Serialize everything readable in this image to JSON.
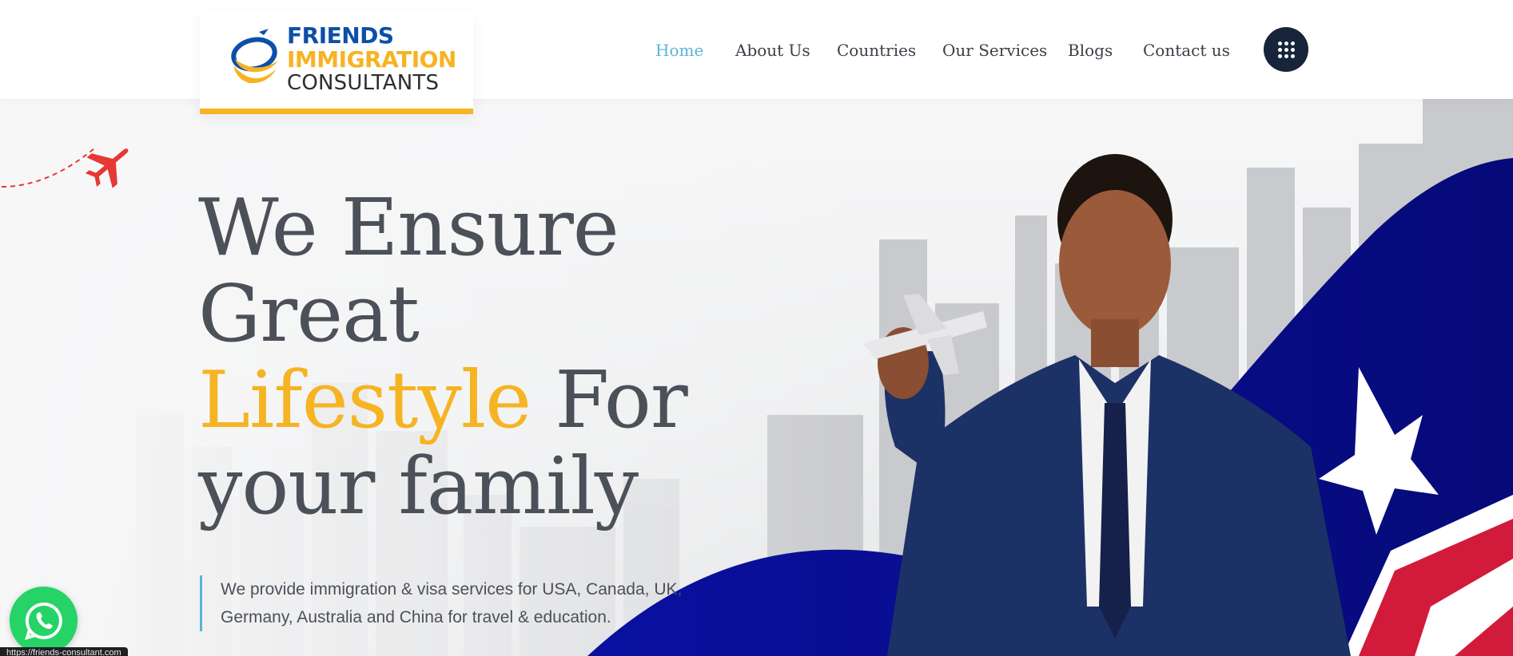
{
  "header": {
    "logo": {
      "line1": "FRIENDS",
      "line2": "IMMIGRATION",
      "line3": "CONSULTANTS"
    },
    "nav": [
      {
        "label": "Home",
        "active": true
      },
      {
        "label": "About Us",
        "active": false
      },
      {
        "label": "Countries",
        "active": false
      },
      {
        "label": "Our Services",
        "active": false
      },
      {
        "label": "Blogs",
        "active": false
      },
      {
        "label": "Contact us",
        "active": false
      }
    ],
    "menu_icon": "grid-dots-icon"
  },
  "hero": {
    "headline": {
      "line1": "We Ensure",
      "line2": "Great",
      "accent": "Lifestyle",
      "after_accent": " For",
      "line4": "your family"
    },
    "subtext_line1": "We provide immigration & visa services for USA, Canada, UK,",
    "subtext_line2": "Germany, Australia and China for travel & education."
  },
  "widgets": {
    "whatsapp_icon": "whatsapp-icon",
    "status_url": "https://friends-consultant.com"
  },
  "colors": {
    "accent": "#f6b322",
    "brand_blue": "#0d4fa8",
    "active_link": "#5ab4d6",
    "text": "#4b5059",
    "navy": "#17243a",
    "flag_blue": "#0a0f8f"
  }
}
